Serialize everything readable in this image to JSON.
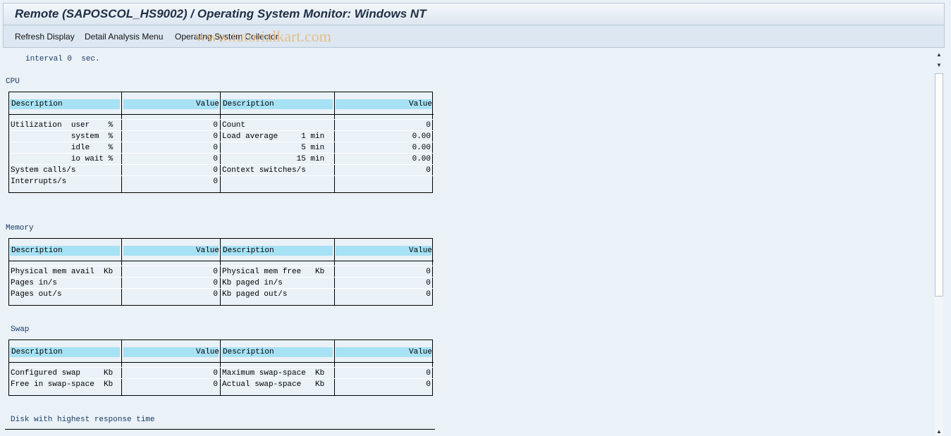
{
  "window": {
    "title": "Remote (SAPOSCOL_HS9002)  / Operating System Monitor: Windows NT"
  },
  "menu": {
    "items": [
      "Refresh Display",
      "Detail Analysis Menu",
      "Operating System Collector"
    ],
    "watermark": "www.tutorialkart.com"
  },
  "interval": {
    "label": "interval",
    "value": "0",
    "unit": "sec."
  },
  "sections": {
    "cpu": {
      "label": "CPU",
      "col_headers": [
        "Description",
        "Value",
        "Description",
        "Value"
      ],
      "rows": [
        [
          "Utilization  user    %",
          "0",
          "Count",
          "0"
        ],
        [
          "             system  %",
          "0",
          "Load average     1 min",
          "0.00"
        ],
        [
          "             idle    %",
          "0",
          "                 5 min",
          "0.00"
        ],
        [
          "             io wait %",
          "0",
          "                15 min",
          "0.00"
        ],
        [
          "System calls/s",
          "0",
          "Context switches/s",
          "0"
        ],
        [
          "Interrupts/s",
          "0",
          "",
          ""
        ]
      ]
    },
    "memory": {
      "label": "Memory",
      "col_headers": [
        "Description",
        "Value",
        "Description",
        "Value"
      ],
      "rows": [
        [
          "Physical mem avail  Kb",
          "0",
          "Physical mem free   Kb",
          "0"
        ],
        [
          "Pages in/s",
          "0",
          "Kb paged in/s",
          "0"
        ],
        [
          "Pages out/s",
          "0",
          "Kb paged out/s",
          "0"
        ]
      ]
    },
    "swap": {
      "label": "Swap",
      "col_headers": [
        "Description",
        "Value",
        "Description",
        "Value"
      ],
      "rows": [
        [
          "Configured swap     Kb",
          "0",
          "Maximum swap-space  Kb",
          "0"
        ],
        [
          "Free in swap-space  Kb",
          "0",
          "Actual swap-space   Kb",
          "0"
        ]
      ]
    },
    "disk": {
      "label": "Disk with highest response time"
    }
  }
}
